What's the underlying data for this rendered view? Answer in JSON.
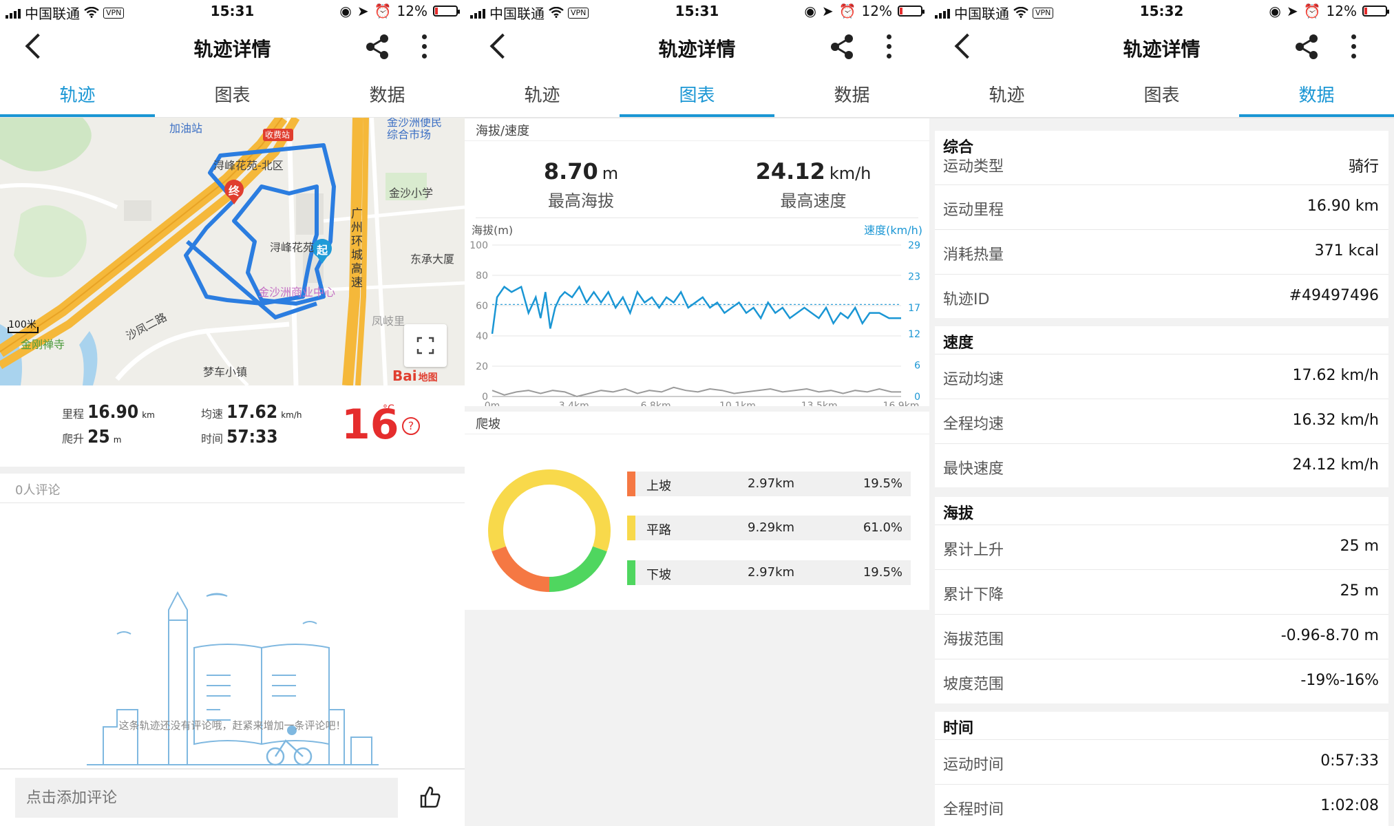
{
  "status_bars": [
    {
      "carrier": "中国联通",
      "vpn": "VPN",
      "time": "15:31",
      "battery": "12%"
    },
    {
      "carrier": "中国联通",
      "vpn": "VPN",
      "time": "15:31",
      "battery": "12%"
    },
    {
      "carrier": "中国联通",
      "vpn": "VPN",
      "time": "15:32",
      "battery": "12%"
    }
  ],
  "header": {
    "title": "轨迹详情"
  },
  "tabs": [
    "轨迹",
    "图表",
    "数据"
  ],
  "track": {
    "map_labels": {
      "gas": "加油站",
      "toll": "收费站",
      "xunfeng_north": "浔峰花苑-北区",
      "xunfeng": "浔峰花苑",
      "market": "金沙洲便民综合市场",
      "school": "金沙小学",
      "highway": "广州环城高速",
      "dongcheng": "东承大厦",
      "biz_center": "金沙洲商业中心",
      "shafeng": "沙凤二路",
      "temple": "金刚禅寺",
      "parking": "梦车小镇",
      "fengqili": "凤岐里",
      "scale": "100米",
      "end_marker": "终",
      "start_marker": "起",
      "baidu": "Bai",
      "baidu_map": "地图"
    },
    "stats": {
      "mileage_label": "里程",
      "mileage_value": "16.90",
      "mileage_unit": "km",
      "climb_label": "爬升",
      "climb_value": "25",
      "climb_unit": "m",
      "avg_speed_label": "均速",
      "avg_speed_value": "17.62",
      "avg_speed_unit": "km/h",
      "time_label": "时间",
      "time_value": "57:33",
      "temperature": "16",
      "temp_unit": "°C",
      "help": "?"
    },
    "comments": {
      "count_label": "0人评论",
      "empty_text": "这条轨迹还没有评论哦，赶紧来增加一条评论吧！",
      "input_placeholder": "点击添加评论"
    }
  },
  "chart_panel": {
    "section_title": "海拔/速度",
    "max_altitude_value": "8.70",
    "max_altitude_unit": "m",
    "max_altitude_label": "最高海拔",
    "max_speed_value": "24.12",
    "max_speed_unit": "km/h",
    "max_speed_label": "最高速度",
    "climb_title": "爬坡",
    "climb_rows": [
      {
        "name": "上坡",
        "distance": "2.97km",
        "percent": "19.5%"
      },
      {
        "name": "平路",
        "distance": "9.29km",
        "percent": "61.0%"
      },
      {
        "name": "下坡",
        "distance": "2.97km",
        "percent": "19.5%"
      }
    ]
  },
  "chart_data": [
    {
      "type": "line",
      "ylabel": "海拔(m)",
      "y2label": "速度(km/h)",
      "x_ticks": [
        "0m",
        "3.4km",
        "6.8km",
        "10.1km",
        "13.5km",
        "16.9km"
      ],
      "y_ticks": [
        "100",
        "80",
        "60",
        "40",
        "20",
        "0"
      ],
      "y2_ticks": [
        "29",
        "23",
        "17",
        "12",
        "6",
        "0"
      ],
      "xlim": [
        0,
        16.9
      ],
      "ylim": [
        0,
        100
      ],
      "y2lim": [
        0,
        29
      ],
      "avg_speed_line": 17.62,
      "series": [
        {
          "axis": "right",
          "color": "#1a96d4",
          "x": [
            0,
            0.2,
            0.5,
            0.8,
            1.2,
            1.5,
            1.8,
            2.0,
            2.2,
            2.4,
            2.6,
            2.8,
            3.0,
            3.3,
            3.6,
            3.9,
            4.2,
            4.5,
            4.8,
            5.1,
            5.4,
            5.7,
            6.0,
            6.3,
            6.6,
            6.9,
            7.2,
            7.5,
            7.8,
            8.1,
            8.4,
            8.7,
            9.0,
            9.3,
            9.6,
            9.9,
            10.2,
            10.5,
            10.8,
            11.1,
            11.4,
            11.7,
            12.0,
            12.3,
            12.6,
            12.9,
            13.2,
            13.5,
            13.8,
            14.1,
            14.4,
            14.7,
            15.0,
            15.3,
            15.6,
            16.0,
            16.4,
            16.9
          ],
          "y": [
            12,
            19,
            21,
            20,
            21,
            16,
            19,
            15,
            20,
            13,
            17,
            19,
            20,
            19,
            21,
            18,
            20,
            18,
            20,
            17,
            19,
            16,
            20,
            18,
            19,
            17,
            19,
            18,
            20,
            17,
            18,
            19,
            17,
            18,
            16,
            17,
            18,
            16,
            17,
            15,
            18,
            16,
            17,
            15,
            16,
            17,
            16,
            15,
            17,
            14,
            16,
            15,
            17,
            14,
            16,
            16,
            15,
            15
          ]
        },
        {
          "axis": "left",
          "color": "#9a9a9a",
          "x": [
            0,
            0.5,
            1.0,
            1.5,
            2.0,
            2.5,
            3.0,
            3.5,
            4.0,
            4.5,
            5.0,
            5.5,
            6.0,
            6.5,
            7.0,
            7.5,
            8.0,
            8.5,
            9.0,
            9.5,
            10.0,
            10.5,
            11.0,
            11.5,
            12.0,
            12.5,
            13.0,
            13.5,
            14.0,
            14.5,
            15.0,
            15.5,
            16.0,
            16.5,
            16.9
          ],
          "y": [
            4,
            1,
            3,
            4,
            2,
            4,
            3,
            0,
            2,
            4,
            3,
            5,
            2,
            4,
            3,
            6,
            4,
            3,
            5,
            4,
            2,
            3,
            4,
            5,
            3,
            4,
            5,
            3,
            4,
            2,
            4,
            3,
            5,
            3,
            3
          ]
        }
      ]
    },
    {
      "type": "pie",
      "donut": true,
      "categories": [
        "上坡",
        "平路",
        "下坡"
      ],
      "values": [
        19.5,
        61.0,
        19.5
      ],
      "colors": [
        "#f57843",
        "#f8d94b",
        "#4fd65f"
      ]
    }
  ],
  "data_panel": {
    "groups": [
      {
        "title": "综合",
        "rows": [
          {
            "k": "运动类型",
            "v": "骑行"
          },
          {
            "k": "运动里程",
            "v": "16.90 km"
          },
          {
            "k": "消耗热量",
            "v": "371 kcal"
          },
          {
            "k": "轨迹ID",
            "v": "#49497496"
          }
        ]
      },
      {
        "title": "速度",
        "rows": [
          {
            "k": "运动均速",
            "v": "17.62 km/h"
          },
          {
            "k": "全程均速",
            "v": "16.32 km/h"
          },
          {
            "k": "最快速度",
            "v": "24.12 km/h"
          }
        ]
      },
      {
        "title": "海拔",
        "rows": [
          {
            "k": "累计上升",
            "v": "25 m"
          },
          {
            "k": "累计下降",
            "v": "25 m"
          },
          {
            "k": "海拔范围",
            "v": "-0.96-8.70 m"
          },
          {
            "k": "坡度范围",
            "v": "-19%-16%"
          }
        ]
      },
      {
        "title": "时间",
        "rows": [
          {
            "k": "运动时间",
            "v": "0:57:33"
          },
          {
            "k": "全程时间",
            "v": "1:02:08"
          }
        ]
      }
    ]
  },
  "colors": {
    "accent": "#1a96d4",
    "temp_red": "#e52d2d",
    "route_blue": "#2b7de0",
    "highway": "#f5b83a"
  }
}
